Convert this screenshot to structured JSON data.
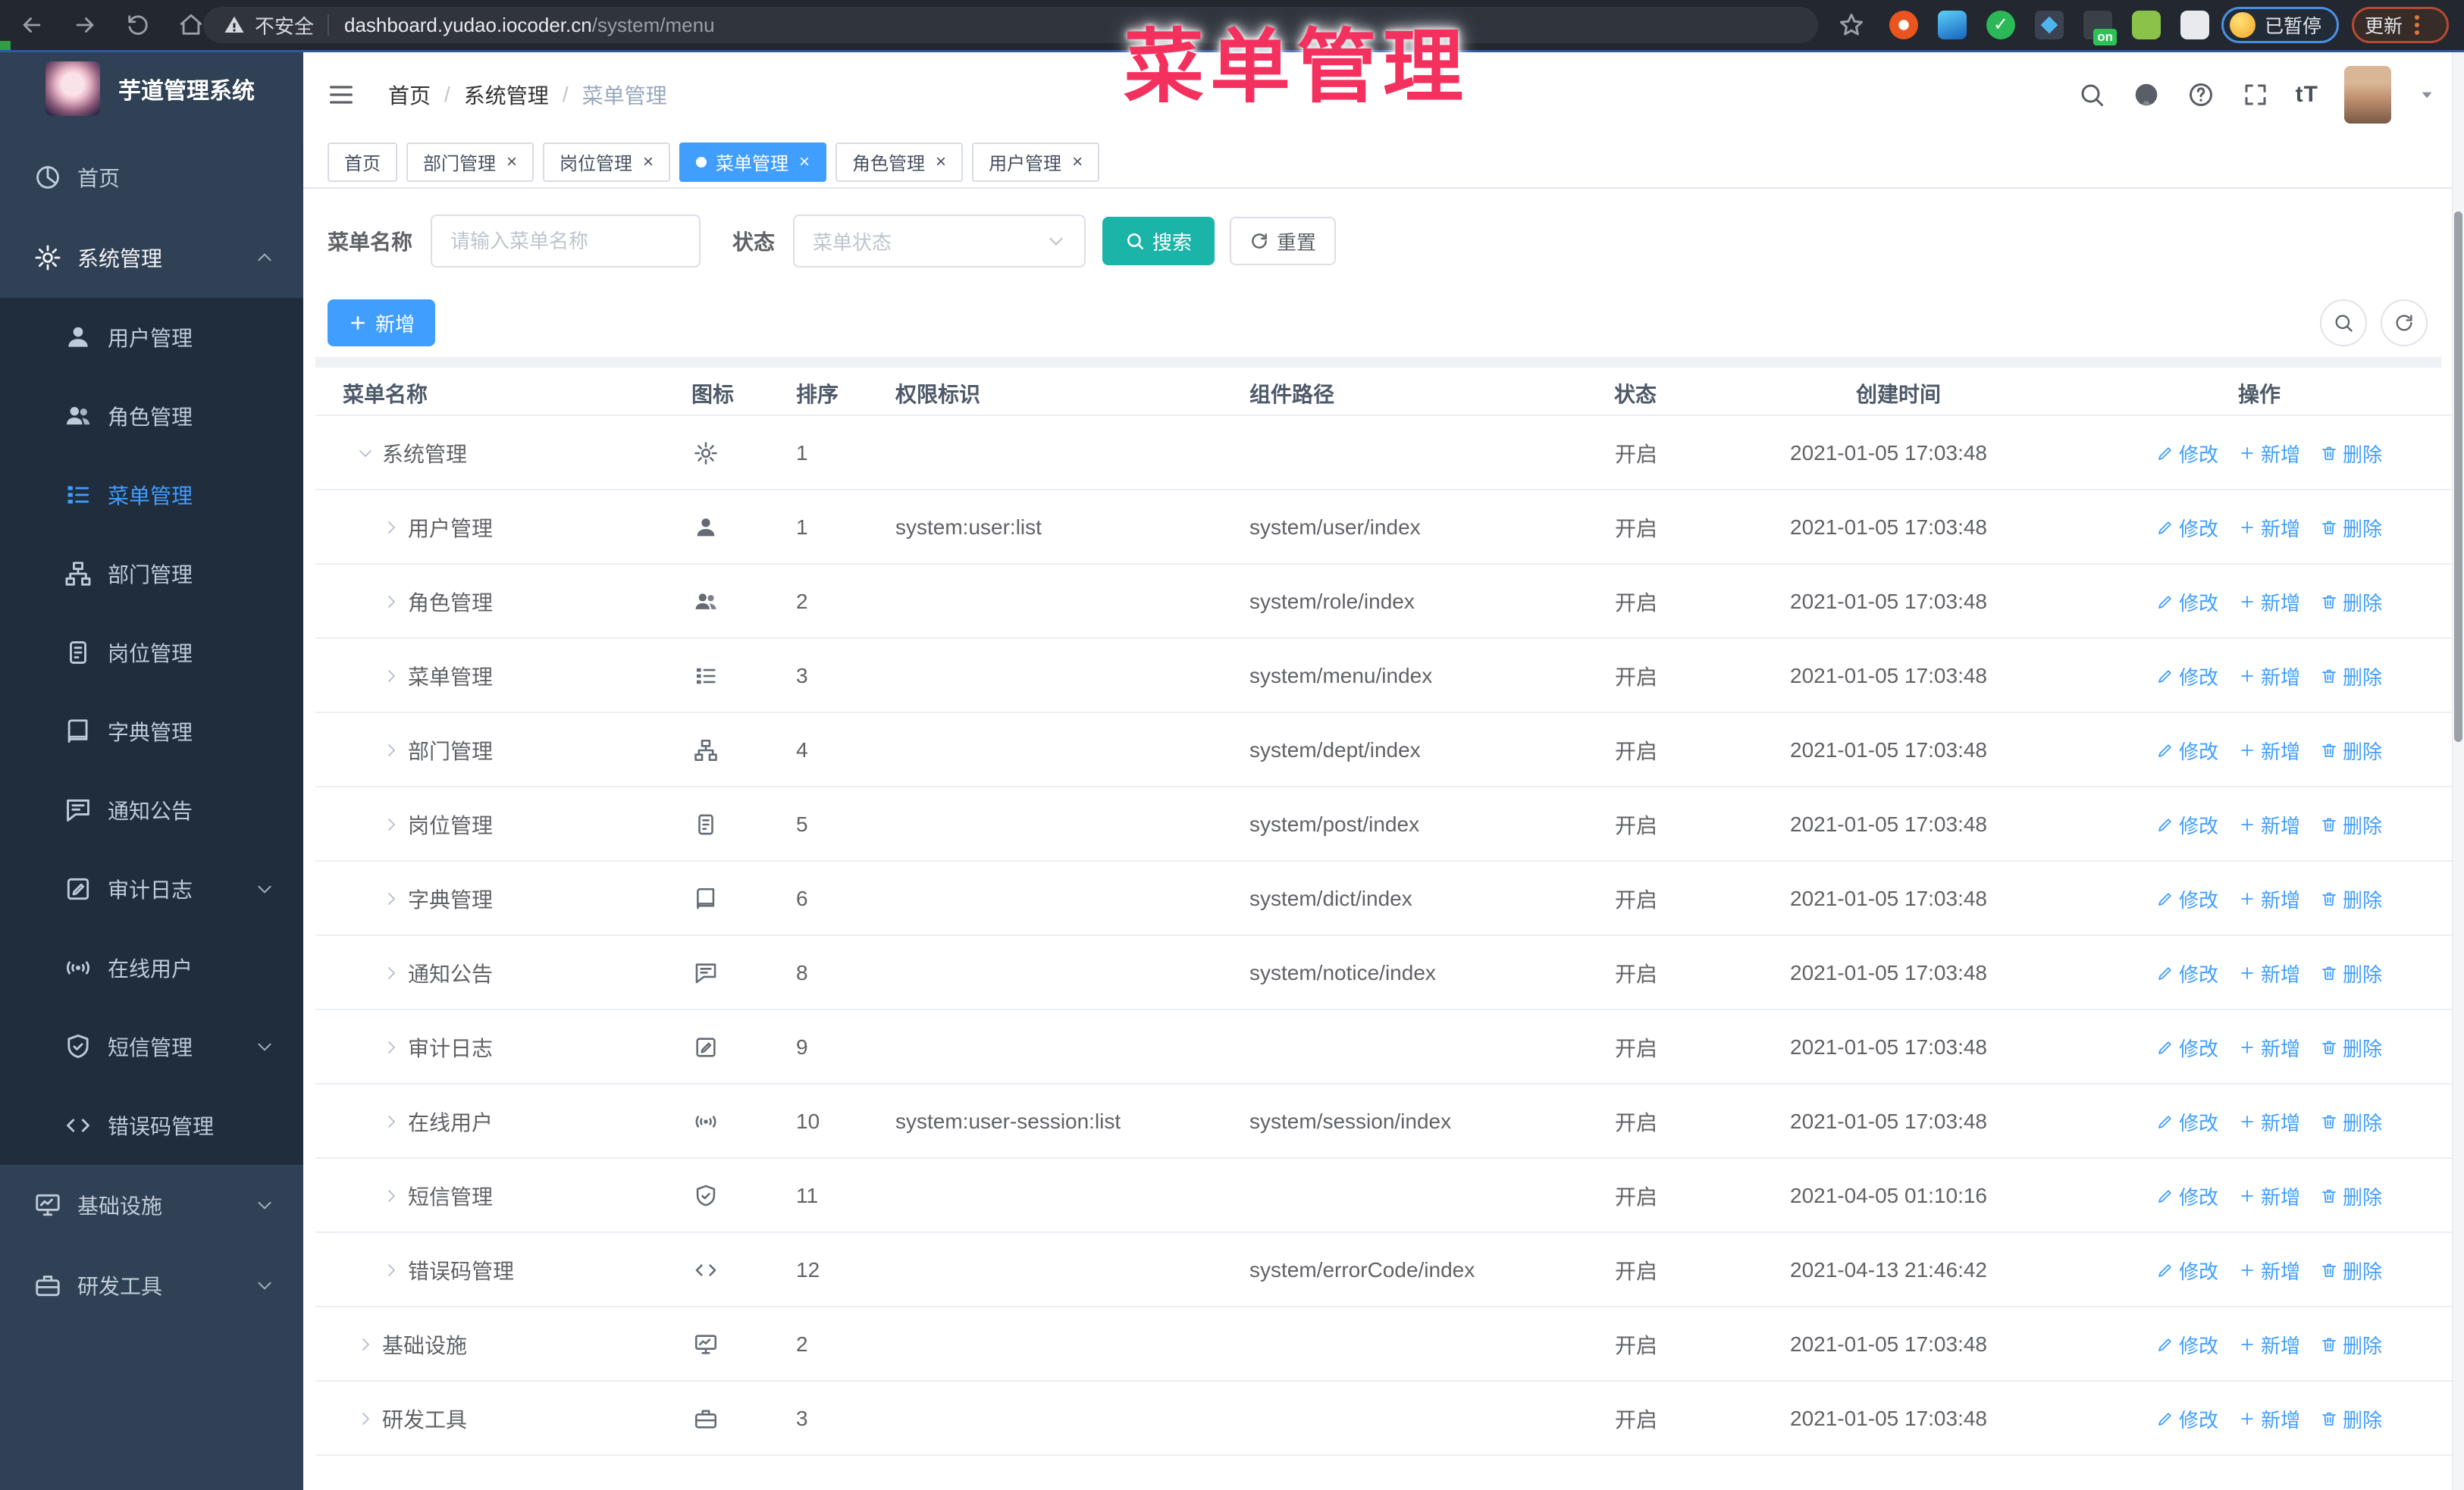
{
  "browser": {
    "security_label": "不安全",
    "url_host": "dashboard.yudao.iocoder.cn",
    "url_path": "/system/menu",
    "ext_on_badge": "on",
    "paused_badge_label": "已暂停",
    "update_button_label": "更新"
  },
  "overlay_title": "菜单管理",
  "sidebar": {
    "logo_title": "芋道管理系统",
    "items": [
      {
        "label": "首页",
        "icon": "dashboard-icon",
        "level": 0
      },
      {
        "label": "系统管理",
        "icon": "gear-icon",
        "level": 0,
        "chevron": "up",
        "open": true
      },
      {
        "label": "用户管理",
        "icon": "user-icon",
        "level": 1
      },
      {
        "label": "角色管理",
        "icon": "users-icon",
        "level": 1
      },
      {
        "label": "菜单管理",
        "icon": "menu-list-icon",
        "level": 1,
        "active": true
      },
      {
        "label": "部门管理",
        "icon": "org-tree-icon",
        "level": 1
      },
      {
        "label": "岗位管理",
        "icon": "post-badge-icon",
        "level": 1
      },
      {
        "label": "字典管理",
        "icon": "dict-book-icon",
        "level": 1
      },
      {
        "label": "通知公告",
        "icon": "notice-icon",
        "level": 1
      },
      {
        "label": "审计日志",
        "icon": "audit-log-icon",
        "level": 1,
        "chevron": "down"
      },
      {
        "label": "在线用户",
        "icon": "online-user-icon",
        "level": 1
      },
      {
        "label": "短信管理",
        "icon": "sms-shield-icon",
        "level": 1,
        "chevron": "down"
      },
      {
        "label": "错误码管理",
        "icon": "error-code-icon",
        "level": 1
      },
      {
        "label": "基础设施",
        "icon": "infra-monitor-icon",
        "level": 0,
        "chevron": "down"
      },
      {
        "label": "研发工具",
        "icon": "dev-tools-icon",
        "level": 0,
        "chevron": "down"
      }
    ]
  },
  "header": {
    "breadcrumb": [
      "首页",
      "系统管理",
      "菜单管理"
    ],
    "text_size_label": "tT"
  },
  "tabs": [
    {
      "label": "首页",
      "closable": false,
      "active": false
    },
    {
      "label": "部门管理",
      "closable": true,
      "active": false
    },
    {
      "label": "岗位管理",
      "closable": true,
      "active": false
    },
    {
      "label": "菜单管理",
      "closable": true,
      "active": true
    },
    {
      "label": "角色管理",
      "closable": true,
      "active": false
    },
    {
      "label": "用户管理",
      "closable": true,
      "active": false
    }
  ],
  "filters": {
    "name_label": "菜单名称",
    "name_placeholder": "请输入菜单名称",
    "status_label": "状态",
    "status_placeholder": "菜单状态",
    "search_label": "搜索",
    "reset_label": "重置"
  },
  "toolbar": {
    "add_label": "新增"
  },
  "table": {
    "columns": [
      "菜单名称",
      "图标",
      "排序",
      "权限标识",
      "组件路径",
      "状态",
      "创建时间",
      "操作"
    ],
    "row_actions": [
      "修改",
      "新增",
      "删除"
    ],
    "rows": [
      {
        "name": "系统管理",
        "level": 0,
        "expanded": true,
        "icon": "gear-icon",
        "sort": "1",
        "perm": "",
        "path": "",
        "status": "开启",
        "time": "2021-01-05 17:03:48"
      },
      {
        "name": "用户管理",
        "level": 1,
        "expanded": false,
        "icon": "user-icon",
        "sort": "1",
        "perm": "system:user:list",
        "path": "system/user/index",
        "status": "开启",
        "time": "2021-01-05 17:03:48"
      },
      {
        "name": "角色管理",
        "level": 1,
        "expanded": false,
        "icon": "users-icon",
        "sort": "2",
        "perm": "",
        "path": "system/role/index",
        "status": "开启",
        "time": "2021-01-05 17:03:48"
      },
      {
        "name": "菜单管理",
        "level": 1,
        "expanded": false,
        "icon": "menu-list-icon",
        "sort": "3",
        "perm": "",
        "path": "system/menu/index",
        "status": "开启",
        "time": "2021-01-05 17:03:48"
      },
      {
        "name": "部门管理",
        "level": 1,
        "expanded": false,
        "icon": "org-tree-icon",
        "sort": "4",
        "perm": "",
        "path": "system/dept/index",
        "status": "开启",
        "time": "2021-01-05 17:03:48"
      },
      {
        "name": "岗位管理",
        "level": 1,
        "expanded": false,
        "icon": "post-badge-icon",
        "sort": "5",
        "perm": "",
        "path": "system/post/index",
        "status": "开启",
        "time": "2021-01-05 17:03:48"
      },
      {
        "name": "字典管理",
        "level": 1,
        "expanded": false,
        "icon": "dict-book-icon",
        "sort": "6",
        "perm": "",
        "path": "system/dict/index",
        "status": "开启",
        "time": "2021-01-05 17:03:48"
      },
      {
        "name": "通知公告",
        "level": 1,
        "expanded": false,
        "icon": "notice-icon",
        "sort": "8",
        "perm": "",
        "path": "system/notice/index",
        "status": "开启",
        "time": "2021-01-05 17:03:48"
      },
      {
        "name": "审计日志",
        "level": 1,
        "expanded": false,
        "icon": "audit-log-icon",
        "sort": "9",
        "perm": "",
        "path": "",
        "status": "开启",
        "time": "2021-01-05 17:03:48"
      },
      {
        "name": "在线用户",
        "level": 1,
        "expanded": false,
        "icon": "online-user-icon",
        "sort": "10",
        "perm": "system:user-session:list",
        "path": "system/session/index",
        "status": "开启",
        "time": "2021-01-05 17:03:48"
      },
      {
        "name": "短信管理",
        "level": 1,
        "expanded": false,
        "icon": "sms-shield-icon",
        "sort": "11",
        "perm": "",
        "path": "",
        "status": "开启",
        "time": "2021-04-05 01:10:16"
      },
      {
        "name": "错误码管理",
        "level": 1,
        "expanded": false,
        "icon": "error-code-icon",
        "sort": "12",
        "perm": "",
        "path": "system/errorCode/index",
        "status": "开启",
        "time": "2021-04-13 21:46:42"
      },
      {
        "name": "基础设施",
        "level": 0,
        "expanded": false,
        "icon": "infra-monitor-icon",
        "sort": "2",
        "perm": "",
        "path": "",
        "status": "开启",
        "time": "2021-01-05 17:03:48"
      },
      {
        "name": "研发工具",
        "level": 0,
        "expanded": false,
        "icon": "dev-tools-icon",
        "sort": "3",
        "perm": "",
        "path": "",
        "status": "开启",
        "time": "2021-01-05 17:03:48"
      }
    ]
  },
  "colors": {
    "accent_blue": "#409eff",
    "teal_button": "#1ab4a8",
    "sidebar_bg": "#304156",
    "sidebar_sub_bg": "#1f2d3d",
    "overlay_pink": "#f4315e"
  }
}
